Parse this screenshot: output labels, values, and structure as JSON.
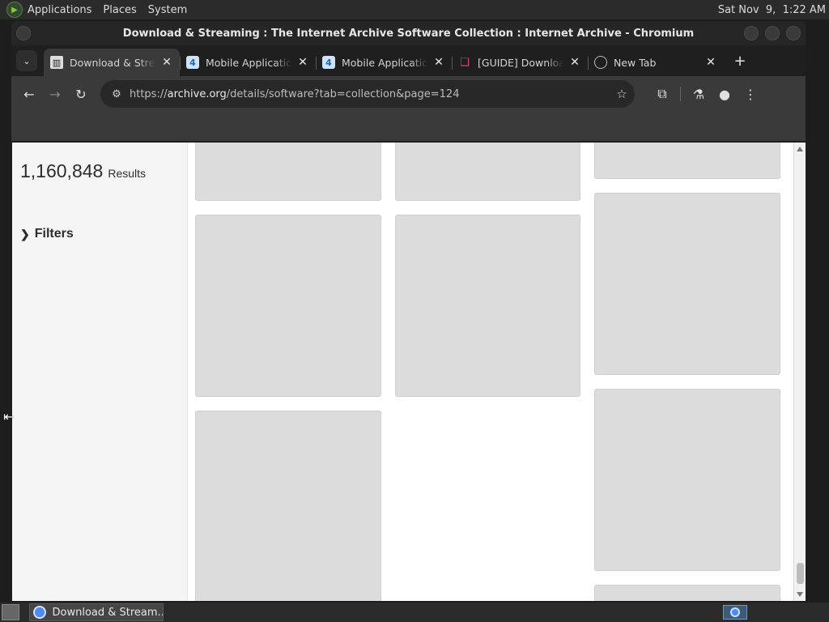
{
  "desktop": {
    "menus": [
      "Applications",
      "Places",
      "System"
    ],
    "clock": "Sat Nov  9,  1:22 AM"
  },
  "window": {
    "title": "Download & Streaming : The Internet Archive Software Collection : Internet Archive - Chromium"
  },
  "tabs": [
    {
      "label": "Download & Streaming : The Internet Archive Software Collection",
      "favicon": "archive-icon",
      "active": true
    },
    {
      "label": "Mobile Applications",
      "favicon": "four-icon",
      "active": false
    },
    {
      "label": "Mobile Applications",
      "favicon": "four-icon",
      "active": false
    },
    {
      "label": "[GUIDE] Download",
      "favicon": "guide-icon",
      "active": false
    },
    {
      "label": "New Tab",
      "favicon": "globe-icon",
      "active": false
    }
  ],
  "toolbar": {
    "url_scheme": "https://",
    "url_host": "archive.org",
    "url_path": "/details/software?tab=collection&page=124"
  },
  "page": {
    "results_count": "1,160,848",
    "results_label": "Results",
    "filters_label": "Filters"
  },
  "taskbar": {
    "task_label": "Download & Stream..."
  },
  "colors": {
    "chrome_dark": "#1f1f1f",
    "toolbar": "#3a3a3a",
    "placeholder_tile": "#dcdcdc",
    "sidebar_bg": "#f5f5f6"
  }
}
